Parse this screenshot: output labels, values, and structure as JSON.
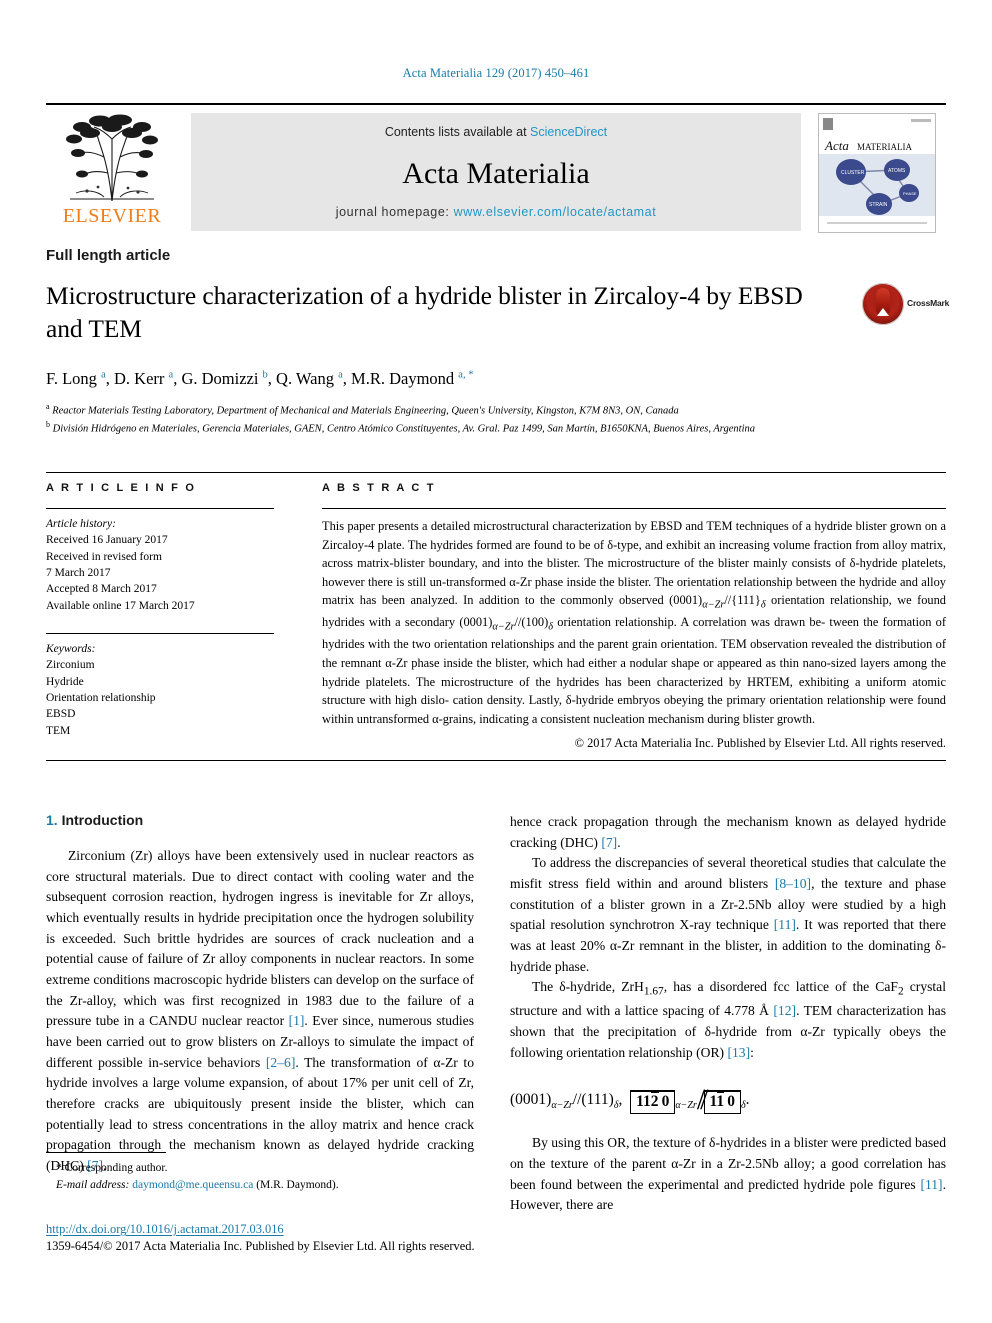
{
  "running_head": "Acta Materialia 129 (2017) 450–461",
  "masthead": {
    "contents_prefix": "Contents lists available at ",
    "sciencedirect": "ScienceDirect",
    "journal_name": "Acta Materialia",
    "homepage_prefix": "journal homepage: ",
    "homepage_url": "www.elsevier.com/locate/actamat",
    "publisher": "ELSEVIER",
    "cover_title_1": "Acta",
    "cover_title_2": "MATERIALIA"
  },
  "article": {
    "type": "Full length article",
    "title": "Microstructure characterization of a hydride blister in Zircaloy-4 by EBSD and TEM",
    "crossmark_label": "CrossMark",
    "authors_html": "F. Long <sup>a</sup>, D. Kerr <sup>a</sup>, G. Domizzi <sup>b</sup>, Q. Wang <sup>a</sup>, M.R. Daymond <sup>a, *</sup>",
    "affiliation_a": "Reactor Materials Testing Laboratory, Department of Mechanical and Materials Engineering, Queen's University, Kingston, K7M 8N3, ON, Canada",
    "affiliation_b": "División Hidrógeno en Materiales, Gerencia Materiales, GAEN, Centro Atómico Constituyentes, Av. Gral. Paz 1499, San Martín, B1650KNA, Buenos Aires, Argentina"
  },
  "section_headers": {
    "article_info": "A R T I C L E  I N F O",
    "abstract": "A B S T R A C T"
  },
  "article_info": {
    "history_label": "Article history:",
    "history_lines": [
      "Received 16 January 2017",
      "Received in revised form",
      "7 March 2017",
      "Accepted 8 March 2017",
      "Available online 17 March 2017"
    ],
    "keywords_label": "Keywords:",
    "keywords": [
      "Zirconium",
      "Hydride",
      "Orientation relationship",
      "EBSD",
      "TEM"
    ]
  },
  "abstract": {
    "text": "This paper presents a detailed microstructural characterization by EBSD and TEM techniques of a hydride blister grown on a Zircaloy-4 plate. The hydrides formed are found to be of δ-type, and exhibit an increasing volume fraction from alloy matrix, across matrix-blister boundary, and into the blister. The microstructure of the blister mainly consists of δ-hydride platelets, however there is still un-transformed α-Zr phase inside the blister. The orientation relationship between the hydride and alloy matrix has been analyzed. In addition to the commonly observed (0001)α−Zr//{111}δ orientation relationship, we found hydrides with a secondary (0001)α−Zr//(100)δ orientation relationship. A correlation was drawn between the formation of hydrides with the two orientation relationships and the parent grain orientation. TEM observation revealed the distribution of the remnant α-Zr phase inside the blister, which had either a nodular shape or appeared as thin nano-sized layers among the hydride platelets. The microstructure of the hydrides has been characterized by HRTEM, exhibiting a uniform atomic structure with high dislocation density. Lastly, δ-hydride embryos obeying the primary orientation relationship were found within untransformed α-grains, indicating a consistent nucleation mechanism during blister growth.",
    "copyright": "© 2017 Acta Materialia Inc. Published by Elsevier Ltd. All rights reserved."
  },
  "introduction": {
    "number": "1.",
    "heading": "Introduction",
    "para1_a": "Zirconium (Zr) alloys have been extensively used in nuclear reactors as core structural materials. Due to direct contact with cooling water and the subsequent corrosion reaction, hydrogen ingress is inevitable for Zr alloys, which eventually results in hydride precipitation once the hydrogen solubility is exceeded. Such brittle hydrides are sources of crack nucleation and a potential cause of failure of Zr alloy components in nuclear reactors. In some extreme conditions macroscopic hydride blisters can develop on the surface of the Zr-alloy, which was first recognized in 1983 due to the failure of a pressure tube in a CANDU nuclear reactor ",
    "ref1": "[1]",
    "para1_b": ". Ever since, numerous studies have been carried out to grow blisters on Zr-alloys to simulate the impact of different possible in-service behaviors ",
    "ref2": "[2–6]",
    "para1_c": ". The transformation of α-Zr to hydride involves a large volume expansion, of about 17% per unit cell of Zr, therefore cracks are ubiquitously present inside the blister, which can potentially lead to stress concentrations in the alloy matrix and hence crack propagation through the mechanism known as delayed hydride cracking (DHC) ",
    "ref7": "[7]",
    "para1_d": ".",
    "para2_a": "To address the discrepancies of several theoretical studies that calculate the misfit stress field within and around blisters ",
    "ref810": "[8–10]",
    "para2_b": ", the texture and phase constitution of a blister grown in a Zr-2.5Nb alloy were studied by a high spatial resolution synchrotron X-ray technique ",
    "ref11": "[11]",
    "para2_c": ". It was reported that there was at least 20% α-Zr remnant in the blister, in addition to the dominating δ-hydride phase.",
    "para3_a": "The δ-hydride, ZrH1.67, has a disordered fcc lattice of the CaF2 crystal structure and with a lattice spacing of 4.778 Å ",
    "ref12": "[12]",
    "para3_b": ". TEM characterization has shown that the precipitation of δ-hydride from α-Zr typically obeys the following orientation relationship (OR) ",
    "ref13": "[13]",
    "para3_c": ":",
    "equation_plain": "(0001)α−Zr//(111)δ, [112̄0]α−Zr // [11̄0]δ.",
    "para4": "By using this OR, the texture of δ-hydrides in a blister were predicted based on the texture of the parent α-Zr in a Zr-2.5Nb alloy; a good correlation has been found between the experimental and predicted hydride pole figures ",
    "ref11b": "[11]",
    "para4_b": ". However, there are"
  },
  "footnote": {
    "corresponding": "* Corresponding author.",
    "email_label": "E-mail address:",
    "email": "daymond@me.queensu.ca",
    "email_suffix": " (M.R. Daymond)."
  },
  "publication": {
    "doi": "http://dx.doi.org/10.1016/j.actamat.2017.03.016",
    "issn_line": "1359-6454/© 2017 Acta Materialia Inc. Published by Elsevier Ltd. All rights reserved."
  },
  "colors": {
    "link": "#1a7aa8",
    "accent": "#2196c4",
    "elsevier_orange": "#ef7d1a"
  }
}
